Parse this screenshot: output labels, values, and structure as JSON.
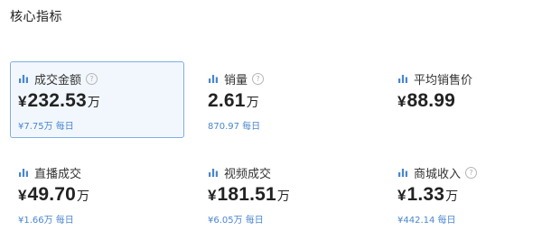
{
  "section": {
    "title": "核心指标"
  },
  "colors": {
    "accent": "#4a86d0",
    "active_border": "#7eaee6"
  },
  "metrics": [
    {
      "label": "成交金额",
      "help": "?",
      "currency": "¥",
      "value": "232.53",
      "unit": "万",
      "sub": "¥7.75万 每日",
      "icon": "bar-chart-icon",
      "active": true
    },
    {
      "label": "销量",
      "help": "?",
      "currency": "",
      "value": "2.61",
      "unit": "万",
      "sub": "870.97 每日",
      "icon": "bar-chart-icon",
      "active": false
    },
    {
      "label": "平均销售价",
      "help": "",
      "currency": "¥",
      "value": "88.99",
      "unit": "",
      "sub": "",
      "icon": "bar-chart-icon",
      "active": false
    },
    {
      "label": "直播成交",
      "help": "",
      "currency": "¥",
      "value": "49.70",
      "unit": "万",
      "sub": "¥1.66万 每日",
      "icon": "bar-chart-icon",
      "active": false
    },
    {
      "label": "视频成交",
      "help": "",
      "currency": "¥",
      "value": "181.51",
      "unit": "万",
      "sub": "¥6.05万 每日",
      "icon": "bar-chart-icon",
      "active": false
    },
    {
      "label": "商城收入",
      "help": "?",
      "currency": "¥",
      "value": "1.33",
      "unit": "万",
      "sub": "¥442.14 每日",
      "icon": "bar-chart-icon",
      "active": false
    }
  ]
}
